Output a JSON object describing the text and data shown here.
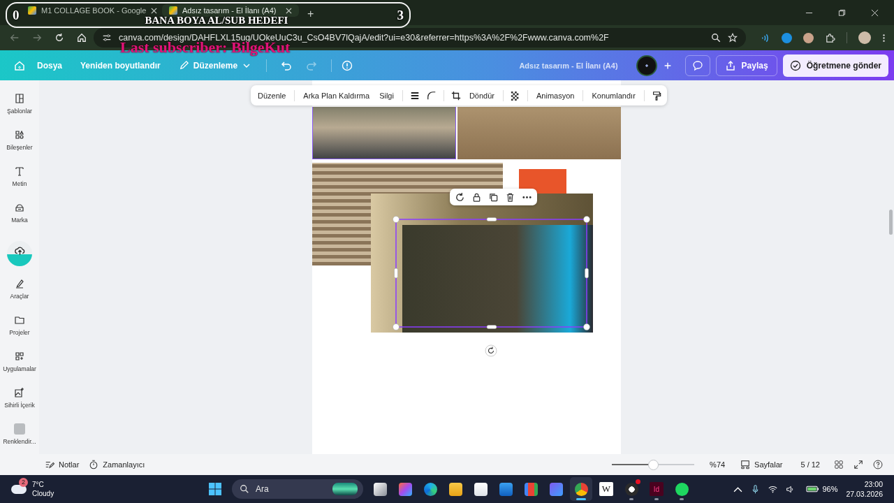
{
  "stream_overlay": {
    "left_count": "0",
    "goal": "BANA BOYA AL/SUB HEDEFI",
    "right_count": "3",
    "last_subscriber": "Last subscriber: BilgeKut"
  },
  "browser": {
    "tabs": [
      {
        "title": "M1 COLLAGE BOOK - Google",
        "selected": false
      },
      {
        "title": "Adsız tasarım - El İlanı (A4)",
        "selected": true
      }
    ],
    "new_tab": "+",
    "nav": [
      {
        "kind": "back",
        "disabled": true
      },
      {
        "kind": "forward",
        "disabled": true
      },
      {
        "kind": "reload",
        "disabled": false
      },
      {
        "kind": "home",
        "disabled": false
      }
    ],
    "url": "canva.com/design/DAHFLXL15ug/UOkeUuC3u_CsO4BV7lQajA/edit?ui=e30&referrer=https%3A%2F%2Fwww.canva.com%2F"
  },
  "editor_header": {
    "menu": [
      {
        "label": "Dosya",
        "kind": "plain"
      },
      {
        "label": "Yeniden boyutlandır",
        "kind": "plain"
      },
      {
        "label": "Düzenleme",
        "kind": "mode"
      }
    ],
    "history": [
      {
        "kind": "undo",
        "disabled": false
      },
      {
        "kind": "redo",
        "disabled": true
      }
    ],
    "design_title": "Adsız tasarım - El İlanı (A4)",
    "share": "Paylaş",
    "submit": "Öğretmene gönder"
  },
  "sidebar": {
    "items": [
      {
        "label": "Şablonlar",
        "kind": "templates"
      },
      {
        "label": "Bileşenler",
        "kind": "elements"
      },
      {
        "label": "Metin",
        "kind": "text"
      },
      {
        "label": "Marka",
        "kind": "brand"
      },
      {
        "kind": "upload"
      },
      {
        "label": "Araçlar",
        "kind": "tools"
      },
      {
        "label": "Projeler",
        "kind": "projects"
      },
      {
        "label": "Uygulamalar",
        "kind": "apps"
      },
      {
        "label": "Sihirli İçerik",
        "kind": "magic"
      },
      {
        "label": "Renklendir...",
        "kind": "colorize"
      }
    ]
  },
  "image_toolbar": {
    "items": [
      {
        "kind": "text",
        "label": "Düzenle",
        "separated": false
      },
      {
        "kind": "text",
        "label": "Arka Plan Kaldırma",
        "separated": true
      },
      {
        "kind": "text",
        "label": "Silgi",
        "separated": false
      },
      {
        "kind": "border",
        "separated": true
      },
      {
        "kind": "corner",
        "separated": false
      },
      {
        "kind": "crop",
        "separated": true
      },
      {
        "kind": "text",
        "label": "Döndür",
        "separated": false
      },
      {
        "kind": "transparency",
        "separated": true
      },
      {
        "kind": "text",
        "label": "Animasyon",
        "separated": true
      },
      {
        "kind": "text",
        "label": "Konumlandır",
        "separated": true
      },
      {
        "kind": "paint",
        "separated": true
      }
    ]
  },
  "bottom_bar": {
    "notes": "Notlar",
    "timer": "Zamanlayıcı",
    "zoom": {
      "level": 0.51,
      "reading": "%74"
    },
    "pages": "Sayfalar",
    "page_count": "5 / 12"
  },
  "taskbar": {
    "weather": {
      "badge": "2",
      "temperature": "7°C",
      "condition": "Cloudy"
    },
    "search": {
      "placeholder": "Ara"
    },
    "apps": [
      {
        "kind": "taskview",
        "running": false,
        "selected": false
      },
      {
        "kind": "copilot",
        "running": false,
        "selected": false
      },
      {
        "kind": "edge",
        "running": false,
        "selected": false
      },
      {
        "kind": "explorer",
        "running": false,
        "selected": false
      },
      {
        "kind": "store",
        "running": false,
        "selected": false
      },
      {
        "kind": "outlook",
        "running": false,
        "selected": false
      },
      {
        "kind": "gmail",
        "running": false,
        "selected": false
      },
      {
        "kind": "hexagon",
        "running": false,
        "selected": false
      },
      {
        "kind": "chrome",
        "running": true,
        "selected": true
      },
      {
        "kind": "letter",
        "label": "W",
        "running": false,
        "selected": false
      },
      {
        "kind": "obs",
        "running": true,
        "selected": false
      },
      {
        "kind": "letter_dark",
        "label": "Id",
        "running": true,
        "selected": false
      },
      {
        "kind": "spotify",
        "running": true,
        "selected": false
      }
    ],
    "battery": "96%",
    "time": "23:00",
    "date": "27.03.2026"
  }
}
